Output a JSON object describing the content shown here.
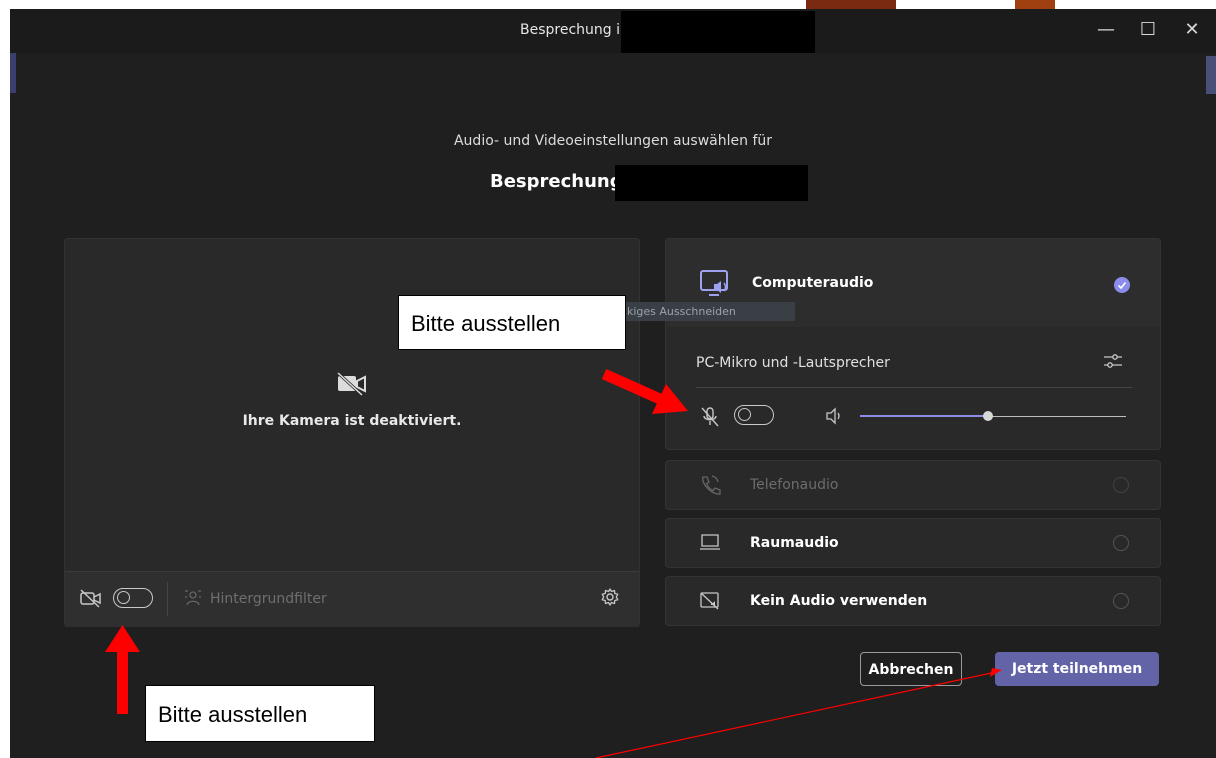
{
  "window": {
    "title": "Besprechung i",
    "controls": {
      "minimize": "—",
      "maximize": "☐",
      "close": "✕"
    }
  },
  "header": {
    "subtitle": "Audio- und Videoeinstellungen auswählen für",
    "meeting_title": "Besprechung"
  },
  "camera": {
    "status_text": "Ihre Kamera ist deaktiviert.",
    "camera_toggle_on": false,
    "background_filter_label": "Hintergrundfilter"
  },
  "audio": {
    "computer_audio_label": "Computeraudio",
    "computer_audio_selected": true,
    "device_label": "PC-Mikro und -Lautsprecher",
    "mic_toggle_on": false,
    "speaker_volume": 0.48,
    "options": [
      {
        "label": "Telefonaudio",
        "enabled": false,
        "selected": false
      },
      {
        "label": "Raumaudio",
        "enabled": true,
        "selected": false
      },
      {
        "label": "Kein Audio verwenden",
        "enabled": true,
        "selected": false
      }
    ]
  },
  "actions": {
    "cancel_label": "Abbrechen",
    "join_label": "Jetzt teilnehmen"
  },
  "annotations": {
    "note_top": "Bitte ausstellen",
    "note_bottom": "Bitte ausstellen",
    "ghost_label": "kiges Ausschneiden"
  },
  "colors": {
    "accent": "#6264a7",
    "check": "#8b8ceb",
    "arrow": "#ff0000",
    "window_bg": "#1f1f1f",
    "panel_bg": "#292929"
  }
}
